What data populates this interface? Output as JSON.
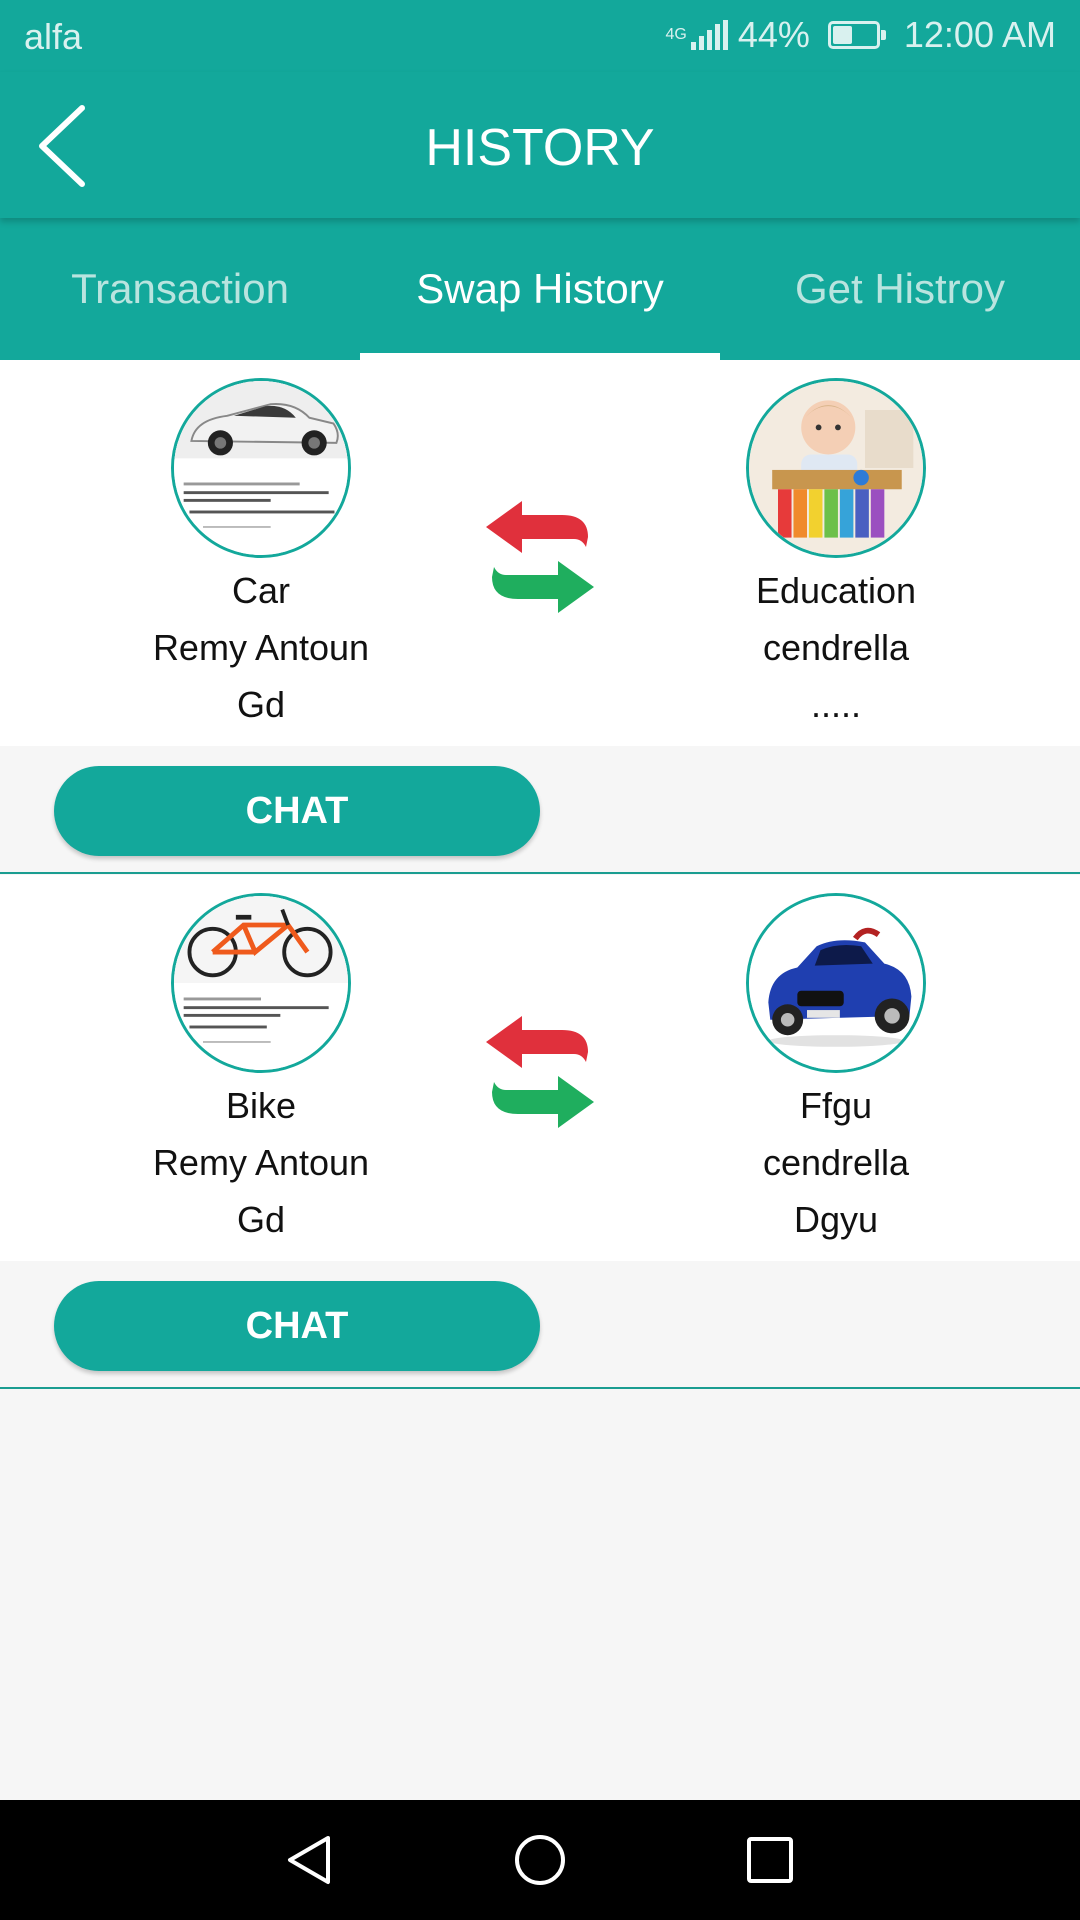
{
  "status_bar": {
    "carrier": "alfa",
    "network": "4G",
    "battery_percent": "44%",
    "battery_level": 0.44,
    "time": "12:00 AM"
  },
  "toolbar": {
    "title": "HISTORY",
    "back_icon": "chevron-left-icon"
  },
  "tabs": [
    {
      "label": "Transaction",
      "active": false
    },
    {
      "label": "Swap History",
      "active": true
    },
    {
      "label": "Get Histroy",
      "active": false
    }
  ],
  "swaps": [
    {
      "left": {
        "lines": [
          "Car",
          "Remy Antoun",
          "Gd"
        ],
        "image": "white toy car"
      },
      "right": {
        "lines": [
          "Education",
          "cendrella",
          "....."
        ],
        "image": "baby with xylophone toy"
      },
      "chat_label": "CHAT"
    },
    {
      "left": {
        "lines": [
          "Bike",
          "Remy Antoun",
          "Gd"
        ],
        "image": "orange kids bike"
      },
      "right": {
        "lines": [
          "Ffgu",
          "cendrella",
          "Dgyu"
        ],
        "image": "blue toy car"
      },
      "chat_label": "CHAT"
    }
  ],
  "colors": {
    "primary": "#13a89b",
    "swap_red": "#e0303c",
    "swap_green": "#1fae5e"
  },
  "nav": {
    "back": "triangle-back-icon",
    "home": "circle-home-icon",
    "recents": "square-recents-icon"
  }
}
